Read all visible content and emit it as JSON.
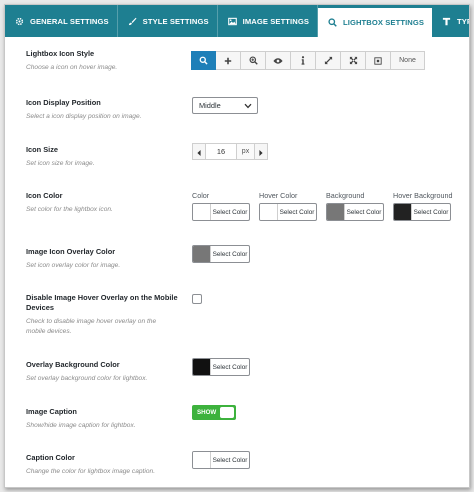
{
  "tabs": [
    {
      "label": "GENERAL SETTINGS",
      "icon": "gear-icon"
    },
    {
      "label": "STYLE SETTINGS",
      "icon": "brush-icon"
    },
    {
      "label": "IMAGE SETTINGS",
      "icon": "image-icon"
    },
    {
      "label": "LIGHTBOX SETTINGS",
      "icon": "search-icon",
      "active": true
    },
    {
      "label": "TYPOGRAPHY",
      "icon": "typography-icon"
    }
  ],
  "colors": {
    "accent": "#1e7f91",
    "selected_button": "#1e7fb8",
    "toggle_on": "#3db23d"
  },
  "settings": {
    "icon_style": {
      "label": "Lightbox Icon Style",
      "desc": "Choose a icon on hover image.",
      "options": [
        "search-icon",
        "plus-icon",
        "zoom-in-icon",
        "eye-icon",
        "info-icon",
        "expand-icon",
        "arrows-icon",
        "square-icon",
        "None"
      ],
      "selected": "search-icon",
      "none_label": "None"
    },
    "icon_position": {
      "label": "Icon Display Position",
      "desc": "Select a icon display position on image.",
      "value": "Middle"
    },
    "icon_size": {
      "label": "Icon Size",
      "desc": "Set icon size for image.",
      "value": "16",
      "unit": "px"
    },
    "icon_color": {
      "label": "Icon Color",
      "desc": "Set color for the lightbox icon.",
      "columns": [
        {
          "title": "Color",
          "button": "Select Color",
          "swatch": "#ffffff"
        },
        {
          "title": "Hover Color",
          "button": "Select Color",
          "swatch": "#ffffff"
        },
        {
          "title": "Background",
          "button": "Select Color",
          "swatch": "#777777"
        },
        {
          "title": "Hover Background",
          "button": "Select Color",
          "swatch": "#222222"
        }
      ]
    },
    "overlay_color": {
      "label": "Image Icon Overlay Color",
      "desc": "Set icon overlay color for image.",
      "button": "Select Color",
      "swatch": "#777777"
    },
    "disable_mobile_overlay": {
      "label_line1": "Disable Image Hover Overlay on the Mobile",
      "label_line2": "Devices",
      "desc_line1": "Check to disable image hover overlay on the",
      "desc_line2": "mobile devices.",
      "checked": false
    },
    "overlay_bg": {
      "label": "Overlay Background Color",
      "desc": "Set overlay background color for lightbox.",
      "button": "Select Color",
      "swatch": "#111111"
    },
    "caption": {
      "label": "Image Caption",
      "desc": "Show/hide image caption for lightbox.",
      "toggle_label": "SHOW",
      "on": true
    },
    "caption_color": {
      "label": "Caption Color",
      "desc": "Change the color for lightbox image caption.",
      "button": "Select Color",
      "swatch": "#ffffff"
    }
  }
}
